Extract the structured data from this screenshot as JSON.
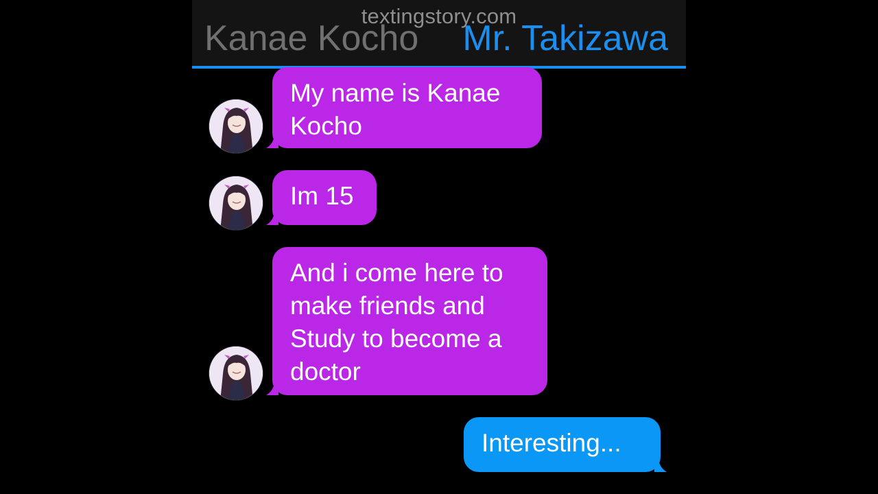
{
  "header": {
    "watermark": "textingstory.com",
    "contact_name": "Kanae Kocho",
    "user_name": "Mr. Takizawa"
  },
  "colors": {
    "header_bg": "#141414",
    "accent_line": "#1a8ff2",
    "contact_name": "#707070",
    "user_name": "#1b8ff0",
    "incoming_bubble": "#bb27e6",
    "outgoing_bubble": "#0a97f5"
  },
  "messages": [
    {
      "sender": "Kanae Kocho",
      "direction": "incoming",
      "text": "My name is Kanae\nKocho",
      "avatar": "kanae-avatar"
    },
    {
      "sender": "Kanae Kocho",
      "direction": "incoming",
      "text": "Im 15",
      "avatar": "kanae-avatar"
    },
    {
      "sender": "Kanae Kocho",
      "direction": "incoming",
      "text": "And i come here to\nmake friends and\nStudy to become a\ndoctor",
      "avatar": "kanae-avatar"
    },
    {
      "sender": "Mr. Takizawa",
      "direction": "outgoing",
      "text": "Interesting..."
    }
  ]
}
